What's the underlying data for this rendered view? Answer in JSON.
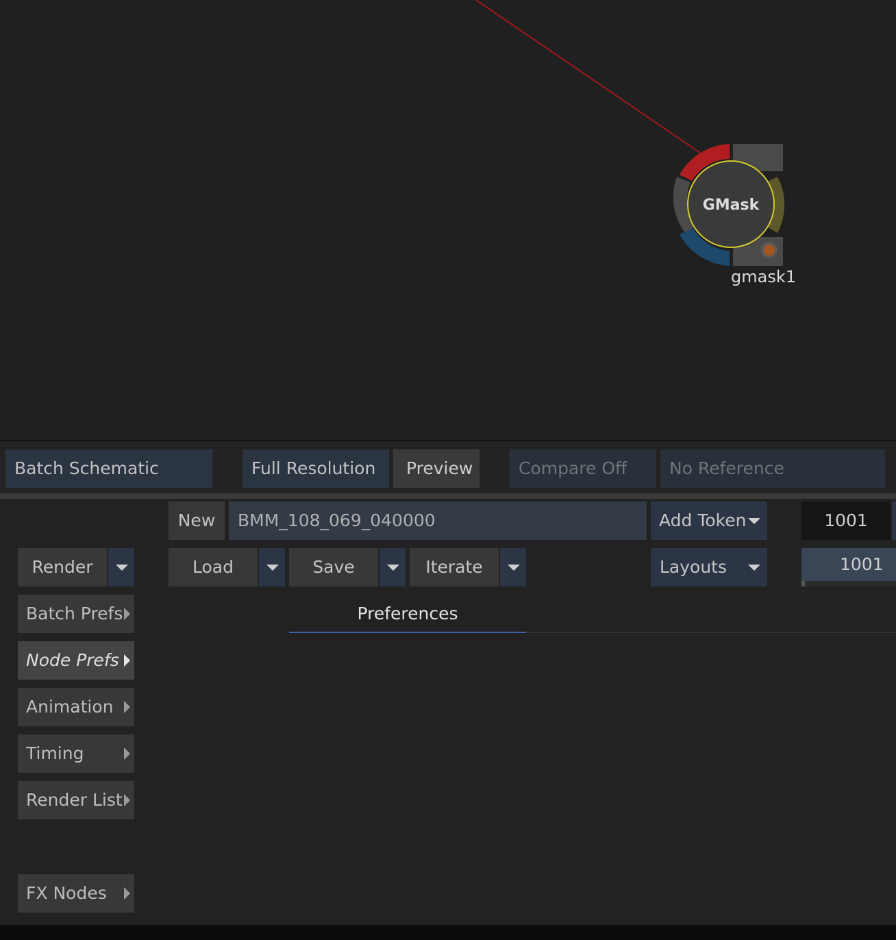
{
  "schematic": {
    "node": {
      "type_label": "GMask",
      "name": "gmask1"
    },
    "colors": {
      "link": "#a0181c",
      "selection_ring": "#d4cc2c",
      "input_red": "#b01e22",
      "input_blue": "#1d4a6c",
      "output_olive": "#5c5a2a",
      "accent_orange": "#a6561d"
    }
  },
  "view_bar": {
    "view_mode": "Batch Schematic",
    "resolution": "Full Resolution",
    "preview": "Preview",
    "compare": "Compare Off",
    "reference": "No Reference"
  },
  "batch": {
    "new_label": "New",
    "setup_name": "BMM_108_069_040000",
    "add_token": "Add Token",
    "frame_start": "1001",
    "frame_current": "1001",
    "render_label": "Render",
    "load_label": "Load",
    "save_label": "Save",
    "iterate_label": "Iterate",
    "layouts_label": "Layouts",
    "tab_preferences": "Preferences"
  },
  "sidebar": {
    "items": [
      {
        "label": "Batch Prefs"
      },
      {
        "label": "Node Prefs"
      },
      {
        "label": "Animation"
      },
      {
        "label": "Timing"
      },
      {
        "label": "Render List"
      },
      {
        "label": "FX Nodes"
      }
    ]
  }
}
